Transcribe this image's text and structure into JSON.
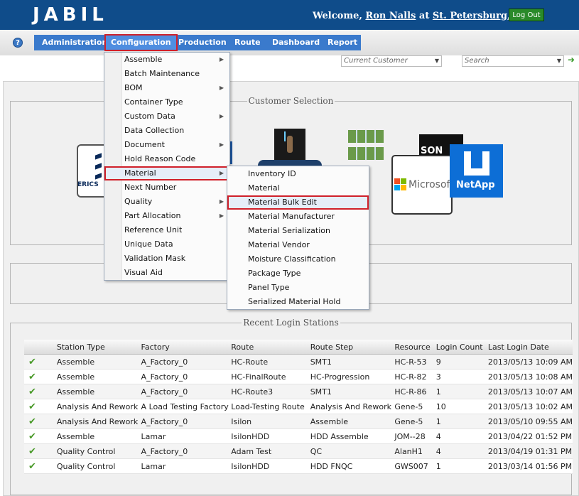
{
  "header": {
    "logo": "JABIL",
    "welcome_prefix": "Welcome,",
    "user": "Ron Nalls",
    "at": "at",
    "site": "St. Petersburg, FL",
    "logout": "Log Out"
  },
  "nav": {
    "help": "?",
    "tabs": [
      "Administration",
      "Configuration",
      "Production",
      "Route",
      "Dashboard",
      "Report"
    ],
    "customer_placeholder": "Current Customer",
    "search_placeholder": "Search"
  },
  "sections": {
    "customer_selection": "Customer Selection",
    "recent_login": "Recent Login Stations"
  },
  "logos": {
    "ericsson": "ERICS",
    "sony": "SON",
    "microsoft": "Microsoft",
    "netapp": "NetApp"
  },
  "config_menu": [
    {
      "label": "Assemble",
      "sub": true
    },
    {
      "label": "Batch Maintenance",
      "sub": false
    },
    {
      "label": "BOM",
      "sub": true
    },
    {
      "label": "Container Type",
      "sub": false
    },
    {
      "label": "Custom Data",
      "sub": true
    },
    {
      "label": "Data Collection",
      "sub": false
    },
    {
      "label": "Document",
      "sub": true
    },
    {
      "label": "Hold Reason Code",
      "sub": false
    },
    {
      "label": "Material",
      "sub": true
    },
    {
      "label": "Next Number",
      "sub": false
    },
    {
      "label": "Quality",
      "sub": true
    },
    {
      "label": "Part Allocation",
      "sub": true
    },
    {
      "label": "Reference Unit",
      "sub": false
    },
    {
      "label": "Unique Data",
      "sub": false
    },
    {
      "label": "Validation Mask",
      "sub": false
    },
    {
      "label": "Visual Aid",
      "sub": false
    }
  ],
  "material_menu": [
    "Inventory ID",
    "Material",
    "Material Bulk Edit",
    "Material Manufacturer",
    "Material Serialization",
    "Material Vendor",
    "Moisture Classification",
    "Package Type",
    "Panel Type",
    "Serialized Material Hold"
  ],
  "table": {
    "headers": [
      "Station Type",
      "Factory",
      "Route",
      "Route Step",
      "Resource",
      "Login Count",
      "Last Login Date"
    ],
    "rows": [
      [
        "Assemble",
        "A_Factory_0",
        "HC-Route",
        "SMT1",
        "HC-R-53",
        "9",
        "2013/05/13 10:09 AM"
      ],
      [
        "Assemble",
        "A_Factory_0",
        "HC-FinalRoute",
        "HC-Progression",
        "HC-R-82",
        "3",
        "2013/05/13 10:08 AM"
      ],
      [
        "Assemble",
        "A_Factory_0",
        "HC-Route3",
        "SMT1",
        "HC-R-86",
        "1",
        "2013/05/13 10:07 AM"
      ],
      [
        "Analysis And Rework",
        "A Load Testing Factory",
        "Load-Testing Route",
        "Analysis And Rework",
        "Gene-5",
        "10",
        "2013/05/13 10:02 AM"
      ],
      [
        "Analysis And Rework",
        "A_Factory_0",
        "Isilon",
        "Assemble",
        "Gene-5",
        "1",
        "2013/05/10 09:55 AM"
      ],
      [
        "Assemble",
        "Lamar",
        "IsilonHDD",
        "HDD Assemble",
        "JOM--28",
        "4",
        "2013/04/22 01:52 PM"
      ],
      [
        "Quality Control",
        "A_Factory_0",
        "Adam Test",
        "QC",
        "AlanH1",
        "4",
        "2013/04/19 01:31 PM"
      ],
      [
        "Quality Control",
        "Lamar",
        "IsilonHDD",
        "HDD FNQC",
        "GWS007",
        "1",
        "2013/03/14 01:56 PM"
      ]
    ]
  },
  "colors": {
    "header_bg": "#0f4c8a",
    "menubar_bg": "#3a7acc",
    "highlight_red": "#d0202a",
    "check_green": "#4a9a2a"
  }
}
